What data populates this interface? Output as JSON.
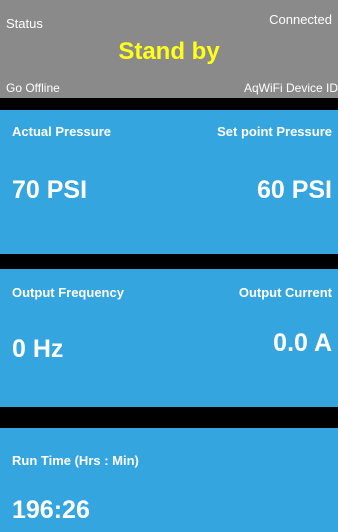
{
  "header": {
    "status_label": "Status",
    "connection": "Connected",
    "mode": "Stand by",
    "offline_link": "Go Offline",
    "device_id_label": "AqWiFi Device ID"
  },
  "pressure": {
    "actual_label": "Actual Pressure",
    "actual_value": "70 PSI",
    "setpoint_label": "Set point Pressure",
    "setpoint_value": "60 PSI"
  },
  "output": {
    "frequency_label": "Output Frequency",
    "frequency_value": "0 Hz",
    "current_label": "Output Current",
    "current_value": "0.0 A"
  },
  "runtime": {
    "label": "Run Time (Hrs : Min)",
    "value": "196:26"
  },
  "colors": {
    "header_bg": "#8a8a8a",
    "panel_bg": "#35a5e0",
    "mode_text": "#ffff1a",
    "separator": "#000000"
  }
}
